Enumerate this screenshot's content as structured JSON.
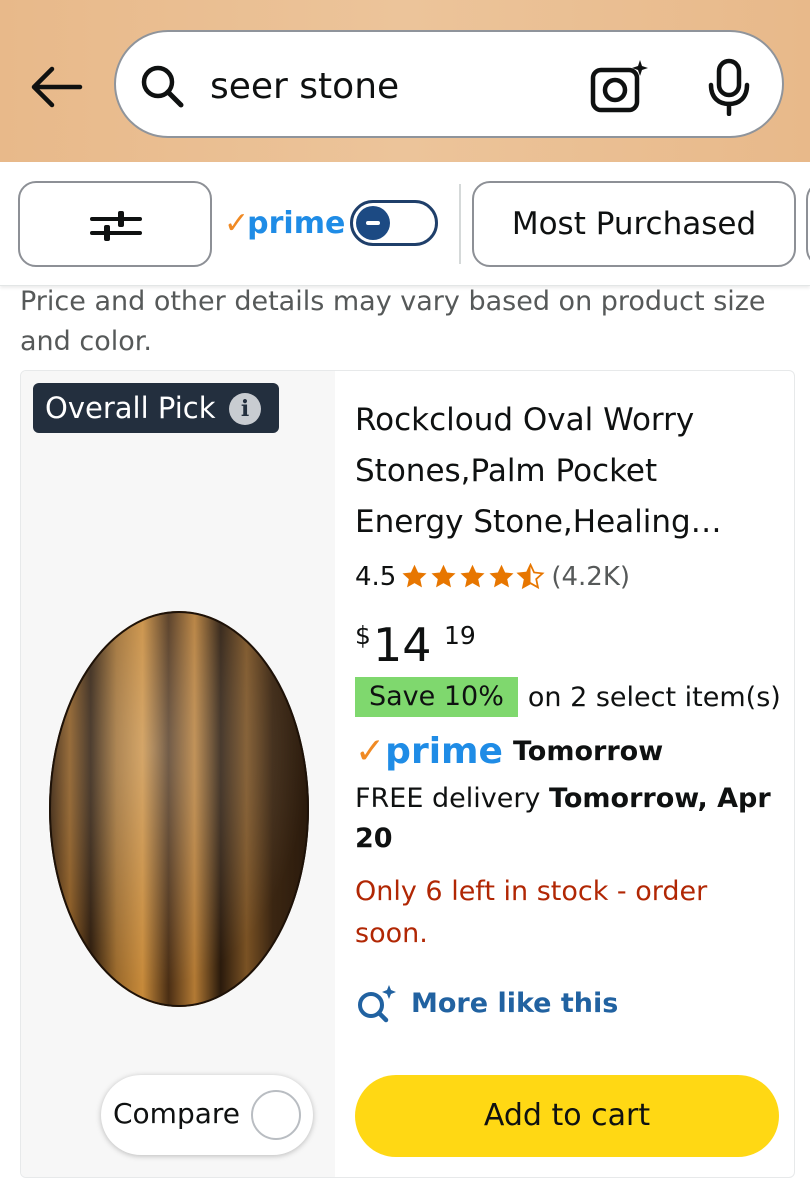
{
  "header": {
    "search_query": "seer stone",
    "icons": [
      "back-arrow-icon",
      "search-icon",
      "camera-icon",
      "microphone-icon"
    ]
  },
  "filters": {
    "filter_icon": "sliders-icon",
    "prime_label": "prime",
    "prime_toggle_state": "off",
    "sort_label": "Most Purchased"
  },
  "disclaimer": "Price and other details may vary based on product size and color.",
  "product": {
    "badge": "Overall Pick",
    "title": "Rockcloud Oval Worry Stones,Palm Pocket Energy Stone,Healing…",
    "rating": "4.5",
    "rating_stars": 4.5,
    "rating_count": "(4.2K)",
    "price_currency": "$",
    "price_whole": "14",
    "price_fraction": "19",
    "save_badge": "Save 10%",
    "save_text": "on 2 select item(s)",
    "prime_label": "prime",
    "prime_delivery_day": "Tomorrow",
    "delivery_prefix": "FREE delivery",
    "delivery_date": "Tomorrow, Apr 20",
    "stock_text": "Only 6 left in stock - order soon.",
    "more_like_this": "More like this",
    "compare_label": "Compare",
    "add_to_cart": "Add to cart"
  },
  "colors": {
    "header_bg": "#e8b98a",
    "prime_blue": "#1f8ce6",
    "prime_orange": "#f08a24",
    "star_orange": "#e77600",
    "save_green": "#7fd86e",
    "stock_red": "#b12704",
    "link_blue": "#2162a1",
    "cart_yellow": "#ffd814"
  }
}
